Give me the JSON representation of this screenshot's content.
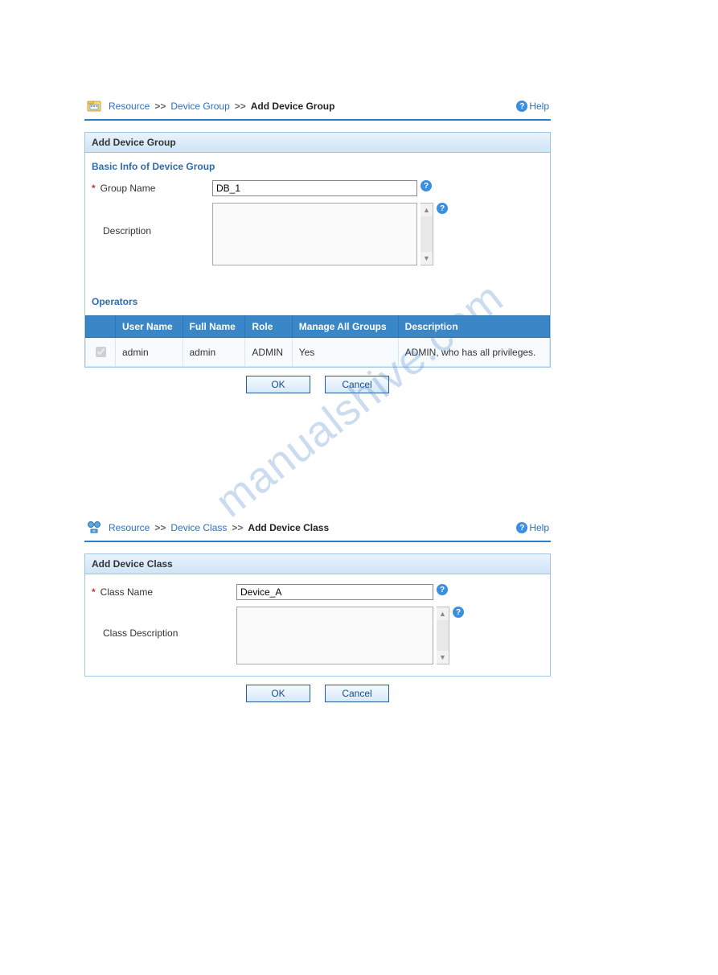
{
  "watermark": "manualshive.com",
  "helpLabel": "Help",
  "breadcrumbSep": ">>",
  "panel1": {
    "breadcrumb": {
      "root": "Resource",
      "mid": "Device Group",
      "current": "Add Device Group"
    },
    "title": "Add Device Group",
    "section1": "Basic Info of Device Group",
    "groupNameLabel": "Group Name",
    "groupNameValue": "DB_1",
    "descriptionLabel": "Description",
    "descriptionValue": "",
    "section2": "Operators",
    "table": {
      "headers": {
        "checkbox": "",
        "userName": "User Name",
        "fullName": "Full Name",
        "role": "Role",
        "manageAll": "Manage All Groups",
        "description": "Description"
      },
      "rows": [
        {
          "checked": true,
          "userName": "admin",
          "fullName": "admin",
          "role": "ADMIN",
          "manageAll": "Yes",
          "description": "ADMIN, who has all privileges."
        }
      ]
    },
    "okLabel": "OK",
    "cancelLabel": "Cancel"
  },
  "panel2": {
    "breadcrumb": {
      "root": "Resource",
      "mid": "Device Class",
      "current": "Add Device Class"
    },
    "title": "Add Device Class",
    "classNameLabel": "Class Name",
    "classNameValue": "Device_A",
    "classDescLabel": "Class Description",
    "classDescValue": "",
    "okLabel": "OK",
    "cancelLabel": "Cancel"
  }
}
